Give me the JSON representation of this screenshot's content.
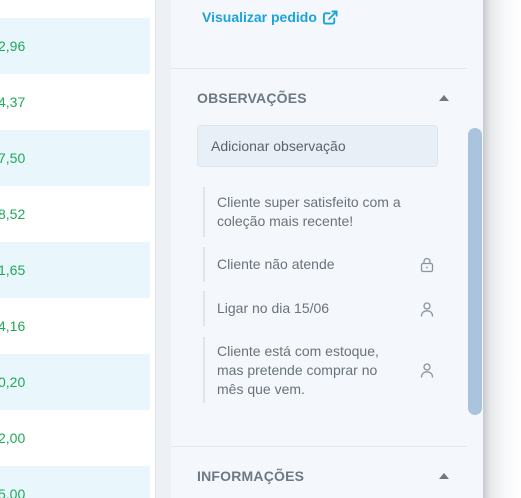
{
  "table": {
    "values": [
      "2,96",
      "4,37",
      "7,50",
      "8,52",
      "1,65",
      "4,16",
      "0,20",
      "2,00",
      "5,00"
    ]
  },
  "drawer": {
    "view_order_label": "Visualizar pedido",
    "observations": {
      "title": "OBSERVAÇÕES",
      "input_placeholder": "Adicionar observação",
      "notes": [
        {
          "text": "Cliente super satisfeito com a coleção mais recente!",
          "icon": ""
        },
        {
          "text": "Cliente não atende",
          "icon": "lock-icon"
        },
        {
          "text": "Ligar no dia 15/06",
          "icon": "user-icon"
        },
        {
          "text": "Cliente está com estoque, mas pretende comprar no mês que vem.",
          "icon": "user-icon"
        }
      ]
    },
    "info": {
      "title": "INFORMAÇÕES"
    }
  },
  "colors": {
    "link": "#1aa3dc",
    "value_green": "#1fa85a",
    "row_alt": "#e9f7fc",
    "drawer_bg": "#f4f8fc"
  }
}
